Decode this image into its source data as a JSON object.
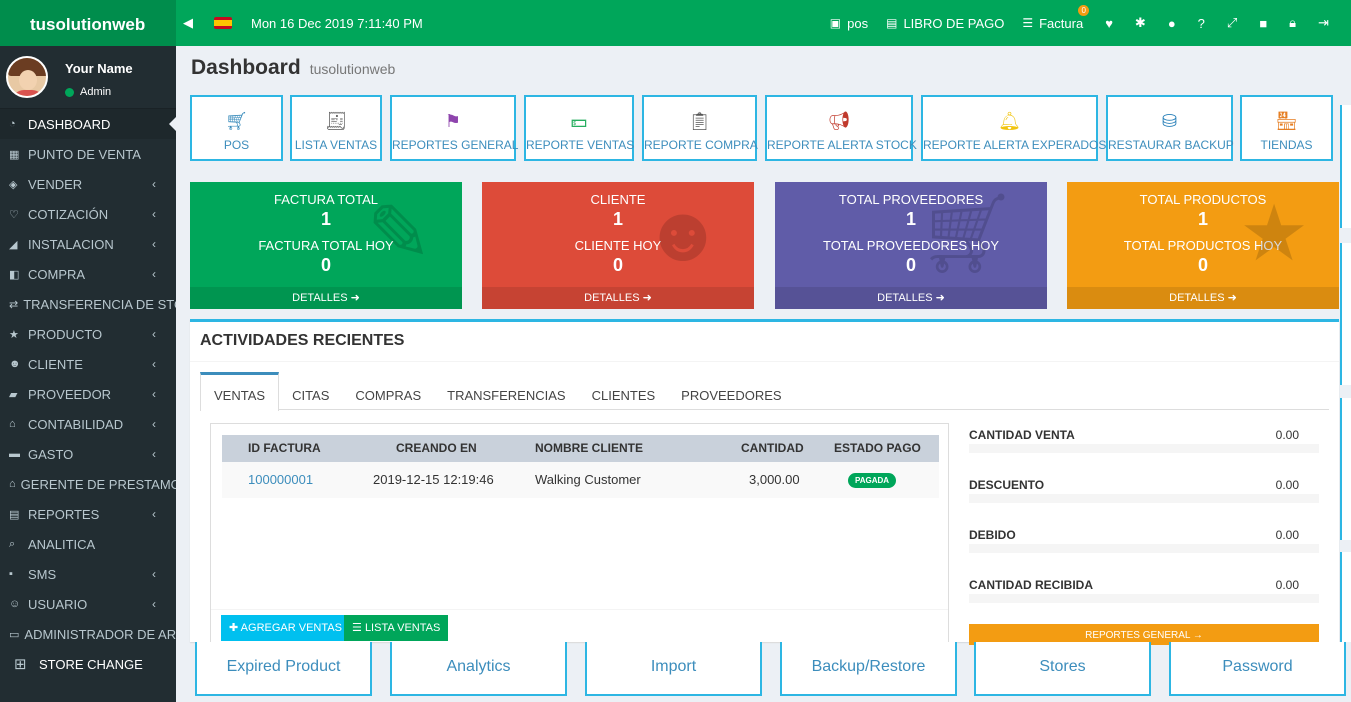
{
  "brand": "tusolutionweb",
  "header": {
    "datetime": "Mon 16 Dec 2019 7:11:40 PM",
    "nav": [
      {
        "icon": "pos-icon",
        "label": "pos"
      },
      {
        "icon": "book-icon",
        "label": "LIBRO DE PAGO"
      },
      {
        "icon": "list-icon",
        "label": "Factura",
        "badge": "0"
      }
    ]
  },
  "user": {
    "name": "Your Name",
    "role": "Admin"
  },
  "sidebar": {
    "items": [
      {
        "label": "DASHBOARD",
        "icon": "dashboard-icon"
      },
      {
        "label": "PUNTO DE VENTA",
        "icon": "pos-icon"
      },
      {
        "label": "VENDER",
        "icon": "money-icon"
      },
      {
        "label": "COTIZACIÓN",
        "icon": "heart-icon"
      },
      {
        "label": "INSTALACION",
        "icon": "chart-icon"
      },
      {
        "label": "COMPRA",
        "icon": "bag-icon"
      },
      {
        "label": "TRANSFERENCIA DE STOCK",
        "icon": "exchange-icon"
      },
      {
        "label": "PRODUCTO",
        "icon": "star-icon"
      },
      {
        "label": "CLIENTE",
        "icon": "users-icon"
      },
      {
        "label": "PROVEEDOR",
        "icon": "truck-icon"
      },
      {
        "label": "CONTABILIDAD",
        "icon": "bank-icon"
      },
      {
        "label": "GASTO",
        "icon": "minus-icon"
      },
      {
        "label": "GERENTE DE PRESTAMO",
        "icon": "home-icon"
      },
      {
        "label": "REPORTES",
        "icon": "table-icon"
      },
      {
        "label": "ANALITICA",
        "icon": "search-icon"
      },
      {
        "label": "SMS",
        "icon": "sms-icon"
      },
      {
        "label": "USUARIO",
        "icon": "user-icon"
      },
      {
        "label": "ADMINISTRADOR DE ARCHIVOS",
        "icon": "folder-icon"
      }
    ],
    "store_change": "STORE CHANGE"
  },
  "page": {
    "title": "Dashboard",
    "subtitle": "tusolutionweb"
  },
  "quick": [
    {
      "label": "POS",
      "icon": "cart-icon"
    },
    {
      "label": "LISTA VENTAS",
      "icon": "receipt-icon"
    },
    {
      "label": "REPORTES GENERAL",
      "icon": "flag-icon"
    },
    {
      "label": "REPORTE VENTAS",
      "icon": "cash-icon"
    },
    {
      "label": "REPORTE COMPRA",
      "icon": "clipboard-icon"
    },
    {
      "label": "REPORTE ALERTA STOCK",
      "icon": "megaphone-icon"
    },
    {
      "label": "REPORTE ALERTA EXPERADOS",
      "icon": "bell-icon"
    },
    {
      "label": "RESTAURAR BACKUP",
      "icon": "database-icon"
    },
    {
      "label": "TIENDAS",
      "icon": "store-icon"
    }
  ],
  "stats": [
    {
      "t1": "FACTURA TOTAL",
      "v1": "1",
      "t2": "FACTURA TOTAL HOY",
      "v2": "0",
      "more": "DETALLES",
      "color": "#00a65a",
      "icon": "pencil-icon"
    },
    {
      "t1": "CLIENTE",
      "v1": "1",
      "t2": "CLIENTE HOY",
      "v2": "0",
      "more": "DETALLES",
      "color": "#dd4b39",
      "icon": "users-icon"
    },
    {
      "t1": "TOTAL PROVEEDORES",
      "v1": "1",
      "t2": "TOTAL PROVEEDORES HOY",
      "v2": "0",
      "more": "DETALLES",
      "color": "#605ca8",
      "icon": "cart-icon"
    },
    {
      "t1": "TOTAL PRODUCTOS",
      "v1": "1",
      "t2": "TOTAL PRODUCTOS HOY",
      "v2": "0",
      "more": "DETALLES",
      "color": "#f39c12",
      "icon": "star-icon"
    }
  ],
  "activity": {
    "title": "ACTIVIDADES RECIENTES",
    "tabs": [
      "VENTAS",
      "CITAS",
      "COMPRAS",
      "TRANSFERENCIAS",
      "CLIENTES",
      "PROVEEDORES"
    ],
    "columns": [
      "ID FACTURA",
      "CREANDO EN",
      "NOMBRE CLIENTE",
      "CANTIDAD",
      "ESTADO PAGO"
    ],
    "rows": [
      {
        "id": "100000001",
        "date": "2019-12-15 12:19:46",
        "client": "Walking Customer",
        "amount": "3,000.00",
        "status": "PAGADA"
      }
    ],
    "add_btn": "AGREGAR VENTAS",
    "list_btn": "LISTA VENTAS",
    "summary": [
      {
        "label": "CANTIDAD VENTA",
        "value": "0.00"
      },
      {
        "label": "DESCUENTO",
        "value": "0.00"
      },
      {
        "label": "DEBIDO",
        "value": "0.00"
      },
      {
        "label": "CANTIDAD RECIBIDA",
        "value": "0.00"
      }
    ],
    "report_btn": "REPORTES GENERAL →"
  },
  "bottom": [
    "Expired Product",
    "Analytics",
    "Import",
    "Backup/Restore",
    "Stores",
    "Password"
  ]
}
